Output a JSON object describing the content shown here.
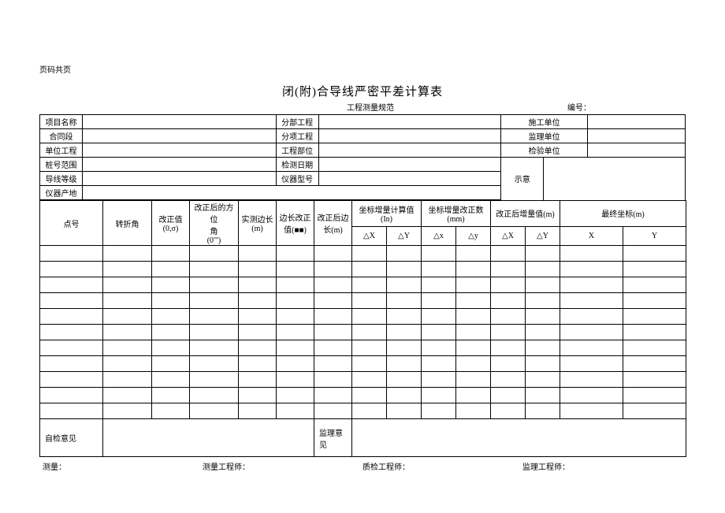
{
  "page_header": "页码共页",
  "title": "闭(附)合导线严密平差计算表",
  "spec_label": "工程测量规范",
  "doc_number_label": "编号：",
  "info": {
    "row1": {
      "l1": "项目名称",
      "l2": "分部工程",
      "l3": "施工单位"
    },
    "row2": {
      "l1": "合同段",
      "l2": "分项工程",
      "l3": "监理单位"
    },
    "row3": {
      "l1": "单位工程",
      "l2": "工程部位",
      "l3": "检验单位"
    },
    "row4": {
      "l1": "桩号范围",
      "l2": "检测日期",
      "l3": "示意"
    },
    "row5": {
      "l1": "导线等级",
      "l2": "仪器型号"
    },
    "row6": {
      "l1": "仪器产地"
    }
  },
  "columns": {
    "c1": "点号",
    "c2": "转折角",
    "c3": "改正值\n(0,σ)",
    "c4": "改正后的方位\n角\n(0'\")",
    "c5": "实测边长\n(m)",
    "c6": "边长改正\n值(■■)",
    "c7": "改正后边\n长(m)",
    "g1": "坐标增量计算值(In)",
    "g2": "坐标增量改正数(mm)",
    "g3": "改正后增量值(m)",
    "g4": "最终坐标(m)",
    "dx": "△X",
    "dy": "△Y",
    "dxl": "△x",
    "dyl": "△y",
    "X": "X",
    "Y": "Y"
  },
  "footer": {
    "self_check": "自检意见",
    "supervision": "监理意见"
  },
  "signatures": {
    "s1": "测量：",
    "s2": "测量工程师：",
    "s3": "质检工程师：",
    "s4": "监理工程师："
  }
}
